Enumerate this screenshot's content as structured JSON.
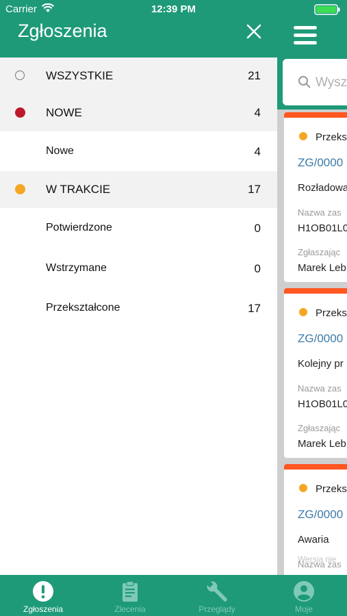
{
  "status_bar": {
    "carrier": "Carrier",
    "time": "12:39 PM"
  },
  "drawer": {
    "title": "Zgłoszenia",
    "items": [
      {
        "label": "WSZYSTKIE",
        "count": "21",
        "indicator": "ring",
        "color": "#777777"
      },
      {
        "label": "NOWE",
        "count": "4",
        "indicator": "dot",
        "color": "#c0182b"
      },
      {
        "label": "Nowe",
        "count": "4"
      },
      {
        "label": "W TRAKCIE",
        "count": "17",
        "indicator": "dot",
        "color": "#f5a623"
      },
      {
        "label": "Potwierdzone",
        "count": "0"
      },
      {
        "label": "Wstrzymane",
        "count": "0"
      },
      {
        "label": "Przekształcone",
        "count": "17"
      }
    ]
  },
  "background": {
    "search_placeholder": "Wysz",
    "cards": [
      {
        "status": "Przeks",
        "code": "ZG/0000",
        "title": "Rozładowa",
        "asset_label": "Nazwa zas",
        "asset": "H1OB01L0",
        "reporter_label": "Zgłaszając",
        "reporter": "Marek Leb"
      },
      {
        "status": "Przeks",
        "code": "ZG/0000",
        "title": "Kolejny pr",
        "asset_label": "Nazwa zas",
        "asset": "H1OB01L0",
        "reporter_label": "Zgłaszając",
        "reporter": "Marek Leb"
      },
      {
        "status": "Przeks",
        "code": "ZG/0000",
        "title": "Awaria",
        "asset_label": "Nazwa zas",
        "version_note": "Wersja nie"
      }
    ]
  },
  "tabs": [
    {
      "label": "Zgłoszenia",
      "icon": "alert-circle-icon",
      "active": true
    },
    {
      "label": "Zlecenia",
      "icon": "clipboard-icon",
      "active": false
    },
    {
      "label": "Przeglądy",
      "icon": "wrench-icon",
      "active": false
    },
    {
      "label": "Moje",
      "icon": "account-icon",
      "active": false
    }
  ],
  "colors": {
    "primary": "#1e9a78",
    "accent_bar": "#ff5722",
    "in_progress": "#f5a623",
    "new": "#c0182b",
    "link": "#3d7aa8"
  }
}
